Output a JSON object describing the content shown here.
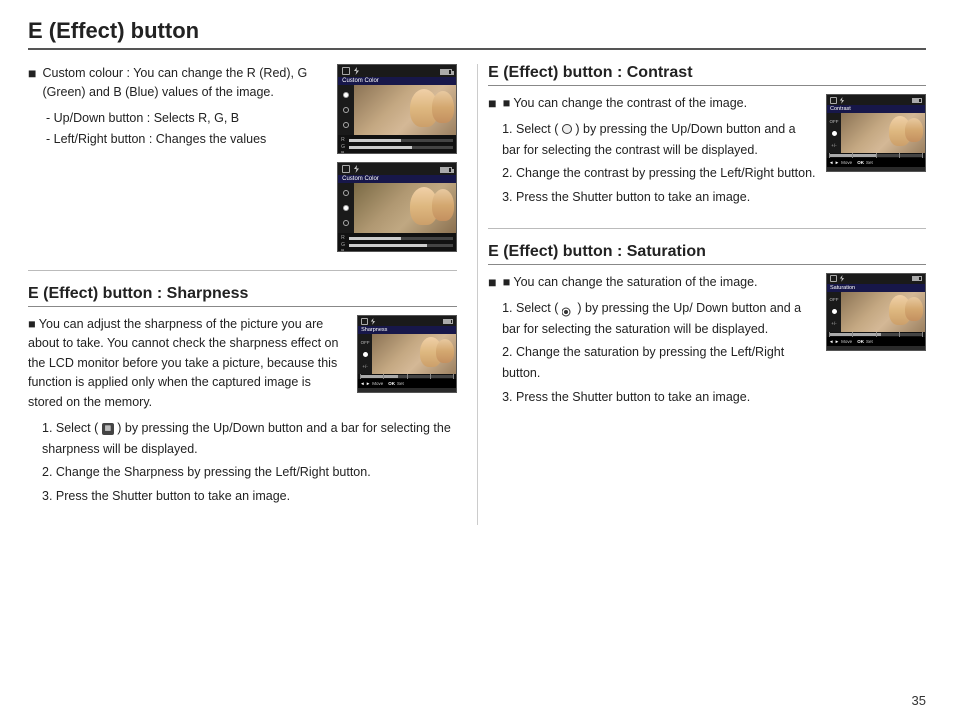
{
  "page": {
    "title": "E (Effect) button",
    "page_number": "35"
  },
  "left_top": {
    "section": null,
    "bullet1": "Custom colour : You can change the R (Red), G (Green) and B (Blue) values of the image.",
    "dash1": "- Up/Down button : Selects R, G, B",
    "dash2": "- Left/Right button : Changes the values"
  },
  "right_top": {
    "section": "E (Effect) button : Contrast",
    "intro": "■ You can change the contrast of the image.",
    "step1": "1. Select (",
    "step1b": ") by pressing the Up/Down button and a bar for selecting the contrast will be displayed.",
    "step2": "2. Change the contrast by pressing the Left/Right button.",
    "step3": "3. Press the Shutter button to take an image."
  },
  "left_bottom": {
    "section": "E (Effect) button : Sharpness",
    "intro": "■ You can adjust the sharpness of the picture you are about to take. You cannot check the sharpness effect on the LCD monitor before you take a picture, because this function is applied only when the captured image is stored on the memory.",
    "step1": "1. Select (",
    "step1b": ") by pressing the Up/Down button and a bar for selecting the sharpness will be displayed.",
    "step2": "2. Change the Sharpness by pressing the Left/Right button.",
    "step3": "3. Press the Shutter button to take an image."
  },
  "right_bottom": {
    "section": "E (Effect) button : Saturation",
    "intro": "■ You can change the saturation of the image.",
    "step1": "1. Select (",
    "step1b": ") by pressing the Up/ Down button and a bar for selecting the saturation will be displayed.",
    "step2": "2. Change the saturation by pressing the Left/Right button.",
    "step3": "3. Press the Shutter button to take an image."
  },
  "cam_labels": {
    "custom_color": "Custom Color",
    "contrast": "Contrast",
    "sharpness": "Sharpness",
    "saturation": "Saturation",
    "move": "Move",
    "ok": "OK",
    "set": "Set",
    "off": "OFF",
    "on": "ON"
  },
  "select_label": "Select"
}
